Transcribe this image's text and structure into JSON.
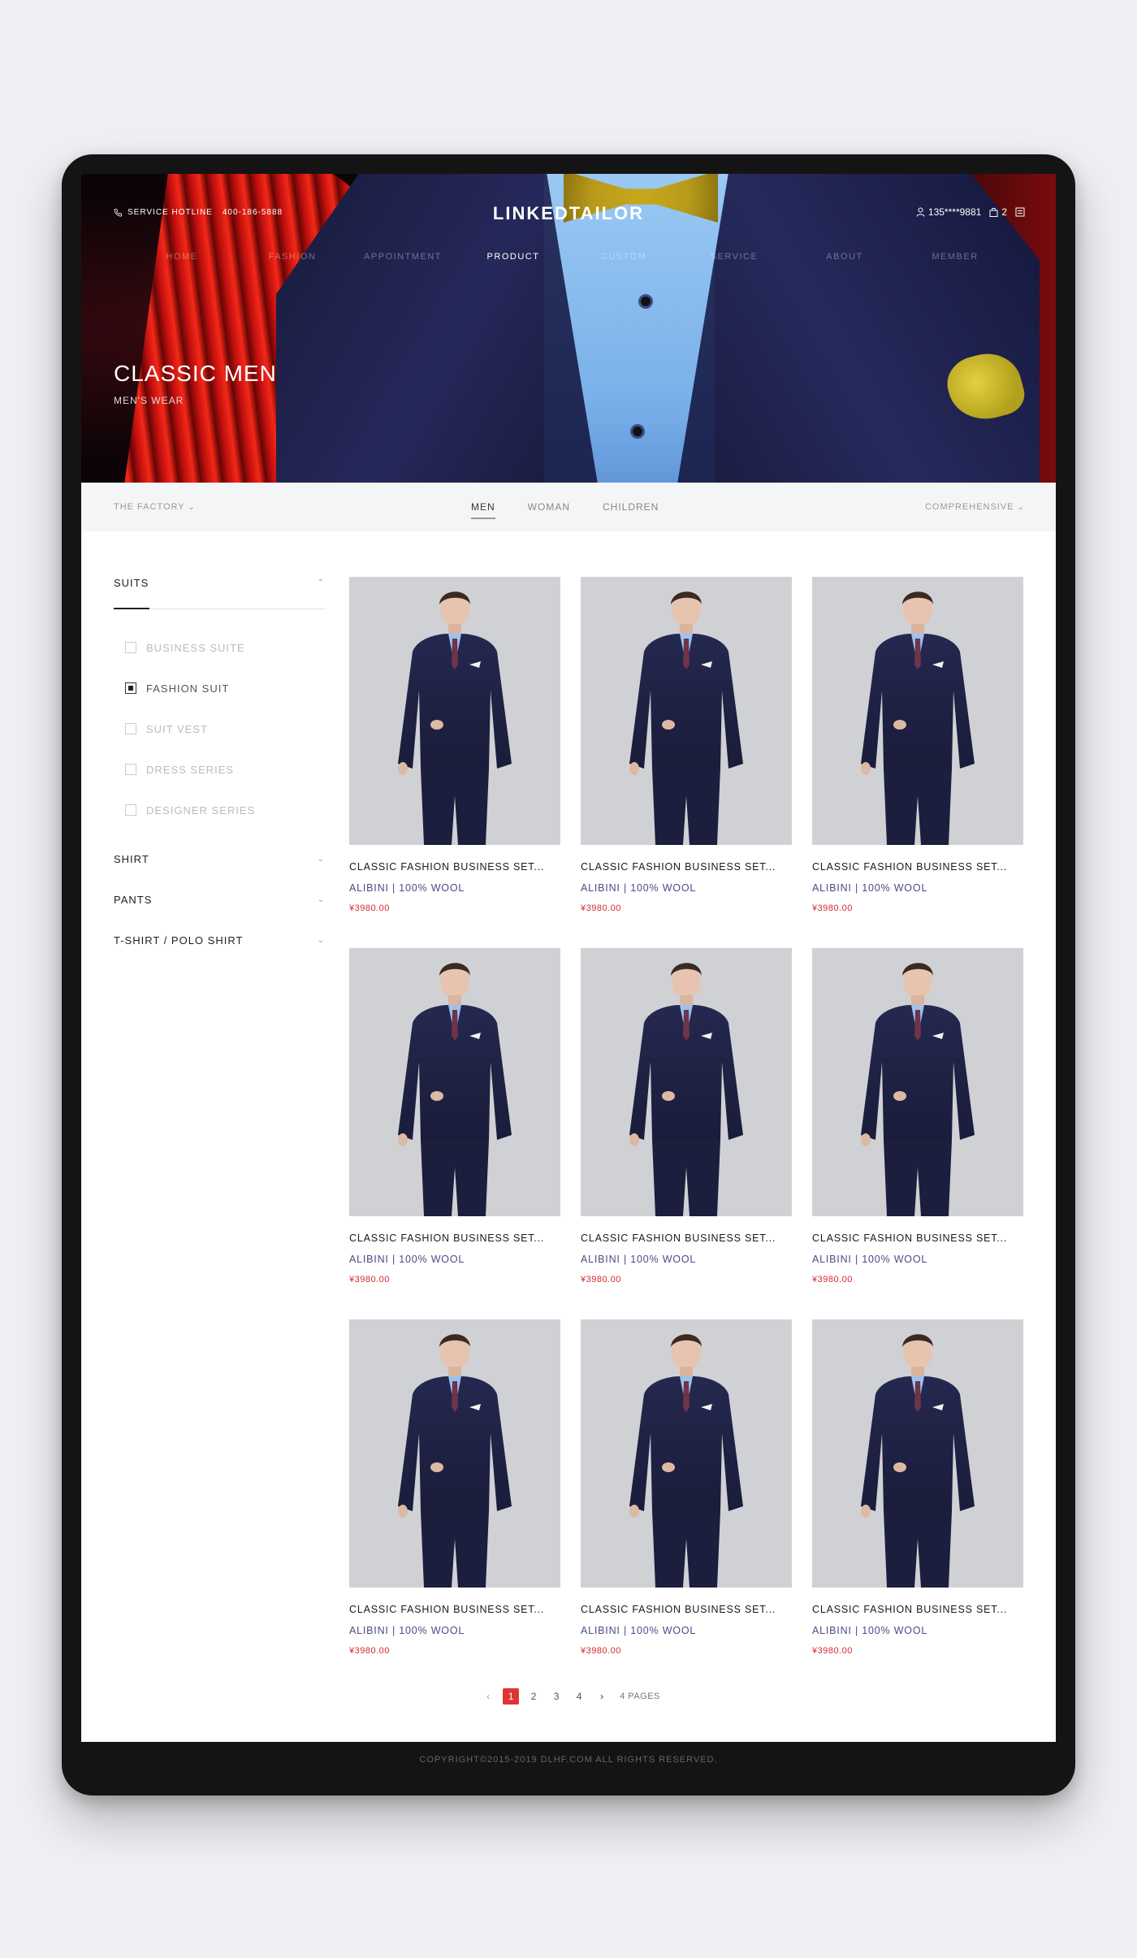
{
  "header": {
    "hotline_label": "SERVICE HOTLINE",
    "hotline_number": "400-186-5888",
    "logo": "LINKEDTAILOR",
    "user": "135****9881",
    "cart_count": "2"
  },
  "nav": {
    "items": [
      "HOME",
      "FASHION",
      "APPOINTMENT",
      "PRODUCT",
      "CUSTOM",
      "SERVICE",
      "ABOUT",
      "MEMBER"
    ],
    "active": "PRODUCT"
  },
  "hero": {
    "title": "CLASSIC MEN",
    "subtitle": "MEN'S WEAR"
  },
  "filter": {
    "left": "THE FACTORY",
    "tabs": [
      "MEN",
      "WOMAN",
      "CHILDREN"
    ],
    "active_tab": "MEN",
    "sort": "COMPREHENSIVE"
  },
  "sidebar": {
    "open_category": "SUITS",
    "sub_items": [
      "BUSINESS SUITE",
      "FASHION SUIT",
      "SUIT VEST",
      "DRESS SERIES",
      "DESIGNER SERIES"
    ],
    "checked_item": "FASHION SUIT",
    "categories": [
      "SHIRT",
      "PANTS",
      "T-SHIRT / POLO SHIRT"
    ]
  },
  "products": [
    {
      "name": "CLASSIC FASHION BUSINESS SET...",
      "brand": "ALIBINI | 100% WOOL",
      "price": "¥3980.00"
    },
    {
      "name": "CLASSIC FASHION BUSINESS SET...",
      "brand": "ALIBINI | 100% WOOL",
      "price": "¥3980.00"
    },
    {
      "name": "CLASSIC FASHION BUSINESS SET...",
      "brand": "ALIBINI | 100% WOOL",
      "price": "¥3980.00"
    },
    {
      "name": "CLASSIC FASHION BUSINESS SET...",
      "brand": "ALIBINI | 100% WOOL",
      "price": "¥3980.00"
    },
    {
      "name": "CLASSIC FASHION BUSINESS SET...",
      "brand": "ALIBINI | 100% WOOL",
      "price": "¥3980.00"
    },
    {
      "name": "CLASSIC FASHION BUSINESS SET...",
      "brand": "ALIBINI | 100% WOOL",
      "price": "¥3980.00"
    },
    {
      "name": "CLASSIC FASHION BUSINESS SET...",
      "brand": "ALIBINI | 100% WOOL",
      "price": "¥3980.00"
    },
    {
      "name": "CLASSIC FASHION BUSINESS SET...",
      "brand": "ALIBINI | 100% WOOL",
      "price": "¥3980.00"
    },
    {
      "name": "CLASSIC FASHION BUSINESS SET...",
      "brand": "ALIBINI | 100% WOOL",
      "price": "¥3980.00"
    }
  ],
  "pagination": {
    "pages": [
      "1",
      "2",
      "3",
      "4"
    ],
    "current": "1",
    "total_label": "4 PAGES"
  },
  "footer": {
    "copyright": "COPYRIGHT©2015-2019 DLHF.COM  ALL RIGHTS RESERVED."
  },
  "colors": {
    "accent": "#e03535",
    "brand_text": "#4a4a8a",
    "price": "#d6282d"
  }
}
